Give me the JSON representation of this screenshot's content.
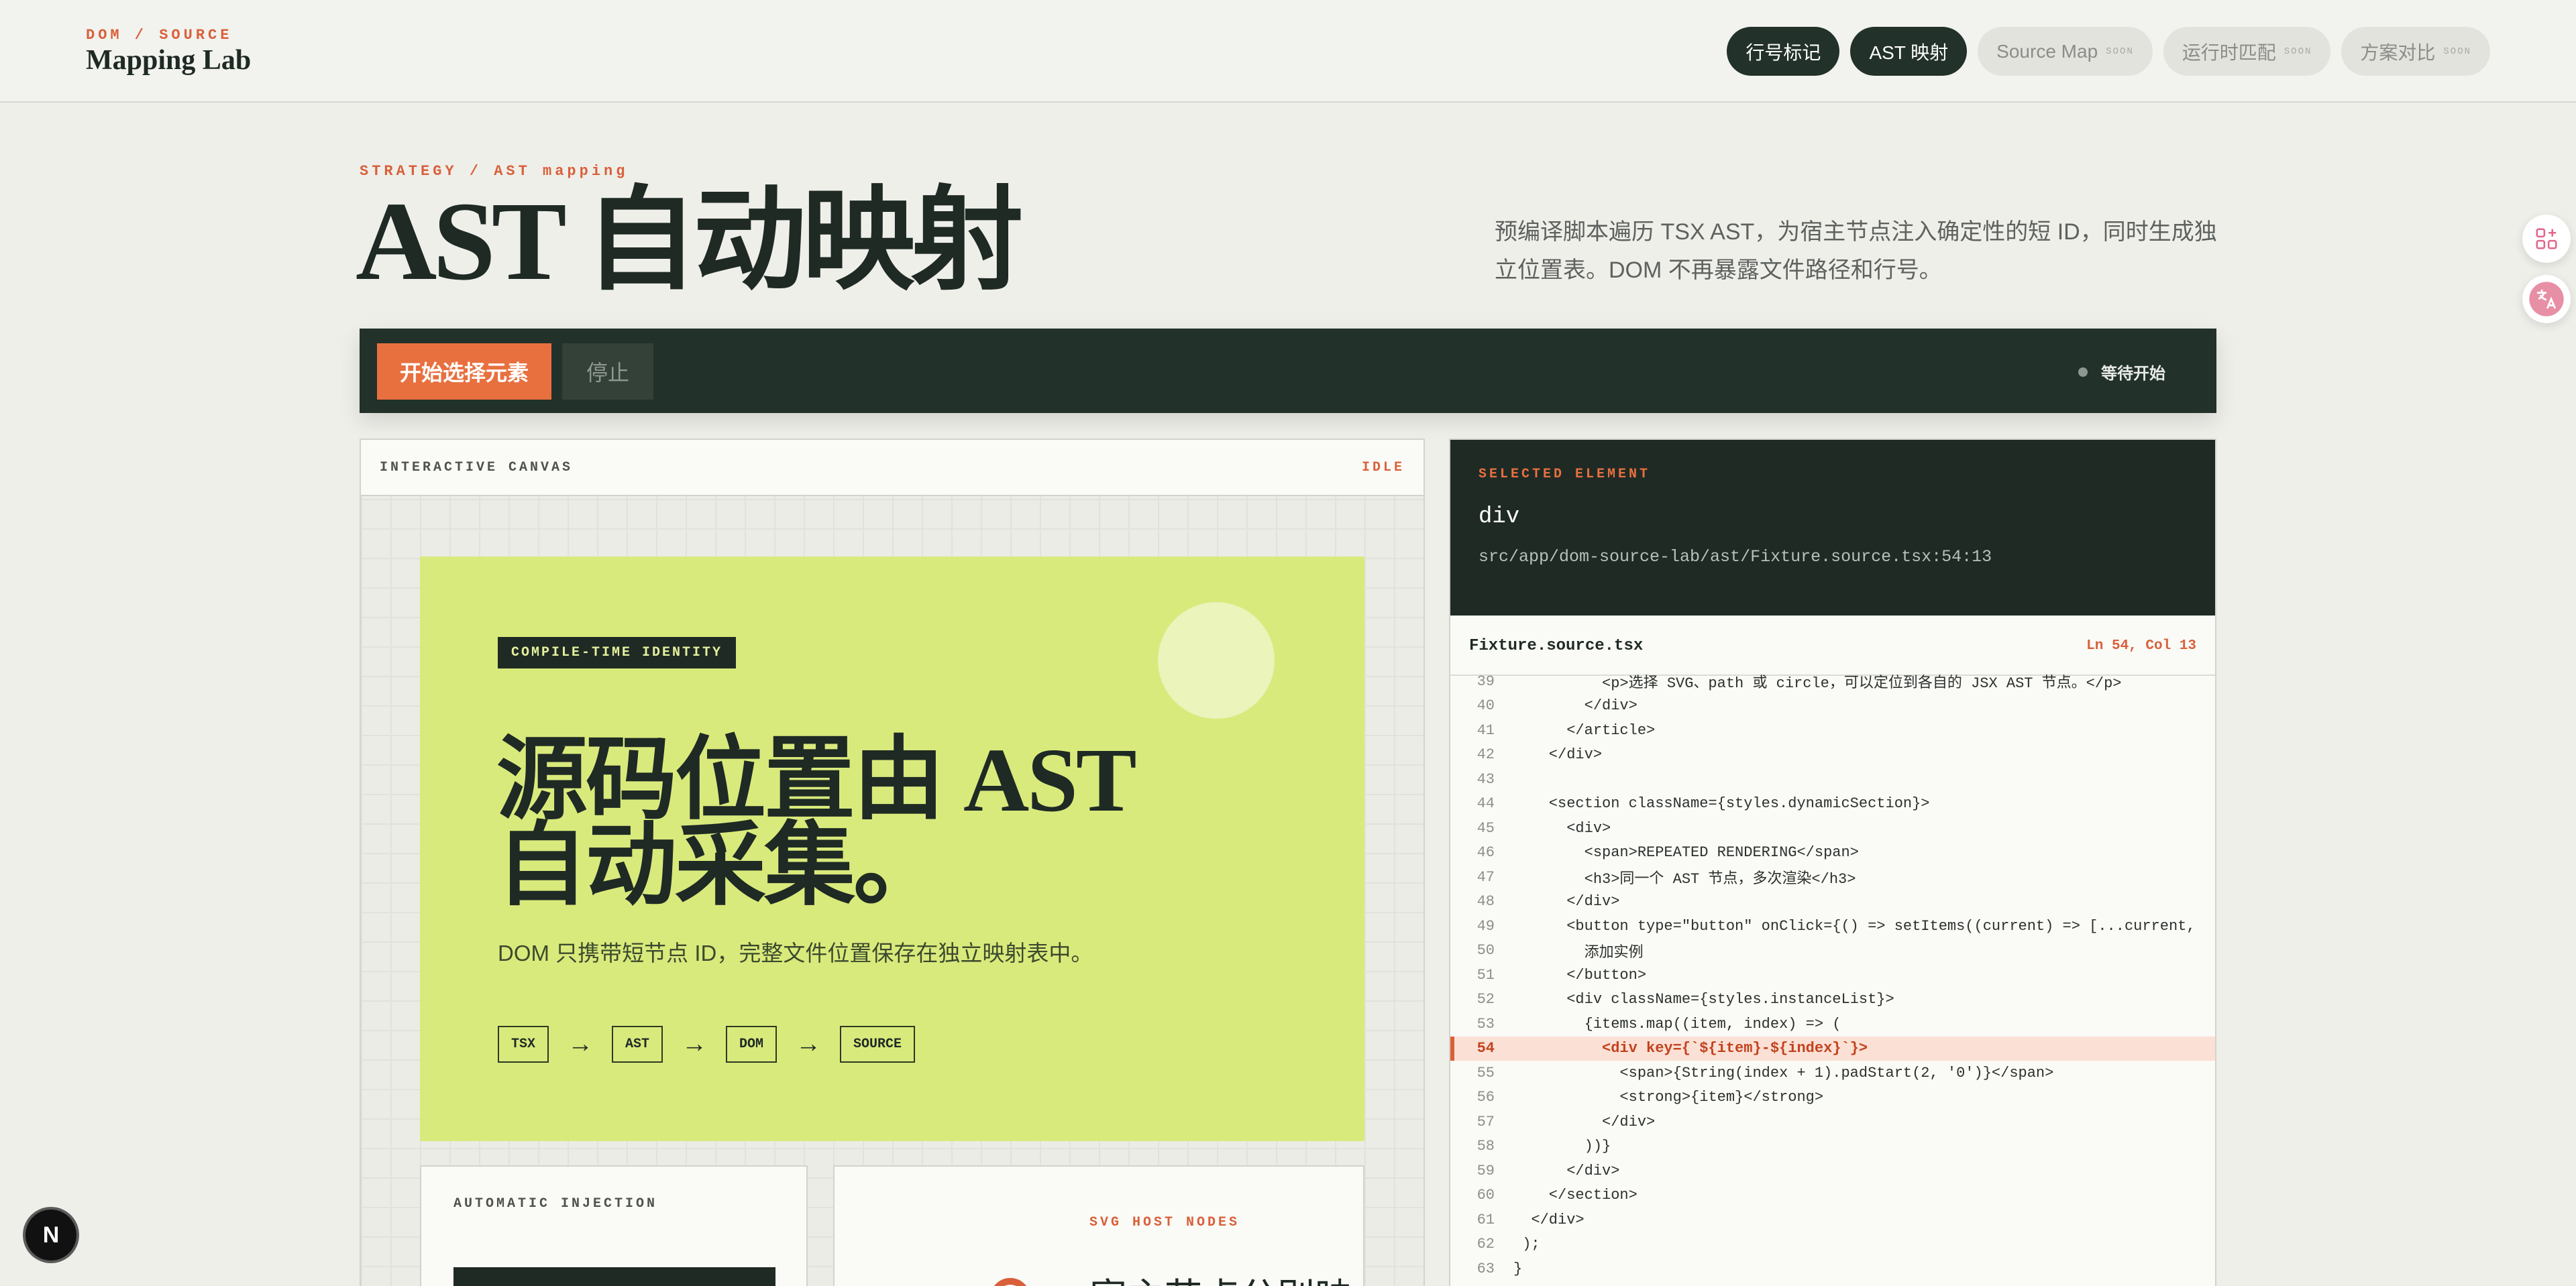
{
  "header": {
    "kicker": "DOM / SOURCE",
    "title": "Mapping Lab",
    "nav": [
      {
        "label": "行号标记",
        "state": "active",
        "soon": ""
      },
      {
        "label": "AST 映射",
        "state": "active",
        "soon": ""
      },
      {
        "label": "Source Map",
        "state": "soon",
        "soon": "SOON"
      },
      {
        "label": "运行时匹配",
        "state": "soon",
        "soon": "SOON"
      },
      {
        "label": "方案对比",
        "state": "soon",
        "soon": "SOON"
      }
    ]
  },
  "hero": {
    "kicker": "STRATEGY / AST mapping",
    "title": "AST 自动映射",
    "description": "预编译脚本遍历 TSX AST，为宿主节点注入确定性的短 ID，同时生成独立位置表。DOM 不再暴露文件路径和行号。"
  },
  "toolbar": {
    "start_label": "开始选择元素",
    "stop_label": "停止",
    "status_label": "等待开始"
  },
  "canvas": {
    "label": "INTERACTIVE CANVAS",
    "state": "IDLE",
    "card": {
      "tag": "COMPILE-TIME IDENTITY",
      "title": "源码位置由 AST 自动采集。",
      "description": "DOM 只携带短节点 ID，完整文件位置保存在独立映射表中。",
      "flow": [
        "TSX",
        "AST",
        "DOM",
        "SOURCE"
      ],
      "arrow": "→"
    },
    "injection_label": "AUTOMATIC INJECTION",
    "svg_label": "SVG HOST NODES",
    "svg_title": "宿主节点分别映"
  },
  "selected": {
    "kicker": "SELECTED ELEMENT",
    "tag": "div",
    "path": "src/app/dom-source-lab/ast/Fixture.source.tsx:54:13",
    "file": "Fixture.source.tsx",
    "position": "Ln 54, Col 13",
    "highlight_line": 54,
    "lines": [
      {
        "n": "39",
        "t": "          <p>选择 SVG、path 或 circle，可以定位到各自的 JSX AST 节点。</p>"
      },
      {
        "n": "40",
        "t": "        </div>"
      },
      {
        "n": "41",
        "t": "      </article>"
      },
      {
        "n": "42",
        "t": "    </div>"
      },
      {
        "n": "43",
        "t": ""
      },
      {
        "n": "44",
        "t": "    <section className={styles.dynamicSection}>"
      },
      {
        "n": "45",
        "t": "      <div>"
      },
      {
        "n": "46",
        "t": "        <span>REPEATED RENDERING</span>"
      },
      {
        "n": "47",
        "t": "        <h3>同一个 AST 节点，多次渲染</h3>"
      },
      {
        "n": "48",
        "t": "      </div>"
      },
      {
        "n": "49",
        "t": "      <button type=\"button\" onClick={() => setItems((current) => [...current,"
      },
      {
        "n": "50",
        "t": "        添加实例"
      },
      {
        "n": "51",
        "t": "      </button>"
      },
      {
        "n": "52",
        "t": "      <div className={styles.instanceList}>"
      },
      {
        "n": "53",
        "t": "        {items.map((item, index) => ("
      },
      {
        "n": "54",
        "t": "          <div key={`${item}-${index}`}>"
      },
      {
        "n": "55",
        "t": "            <span>{String(index + 1).padStart(2, '0')}</span>"
      },
      {
        "n": "56",
        "t": "            <strong>{item}</strong>"
      },
      {
        "n": "57",
        "t": "          </div>"
      },
      {
        "n": "58",
        "t": "        ))}"
      },
      {
        "n": "59",
        "t": "      </div>"
      },
      {
        "n": "60",
        "t": "    </section>"
      },
      {
        "n": "61",
        "t": "  </div>"
      },
      {
        "n": "62",
        "t": " );"
      },
      {
        "n": "63",
        "t": "}"
      }
    ]
  },
  "floating": {
    "badge": "N",
    "icons": [
      "apps-add-icon",
      "translate-icon"
    ]
  }
}
